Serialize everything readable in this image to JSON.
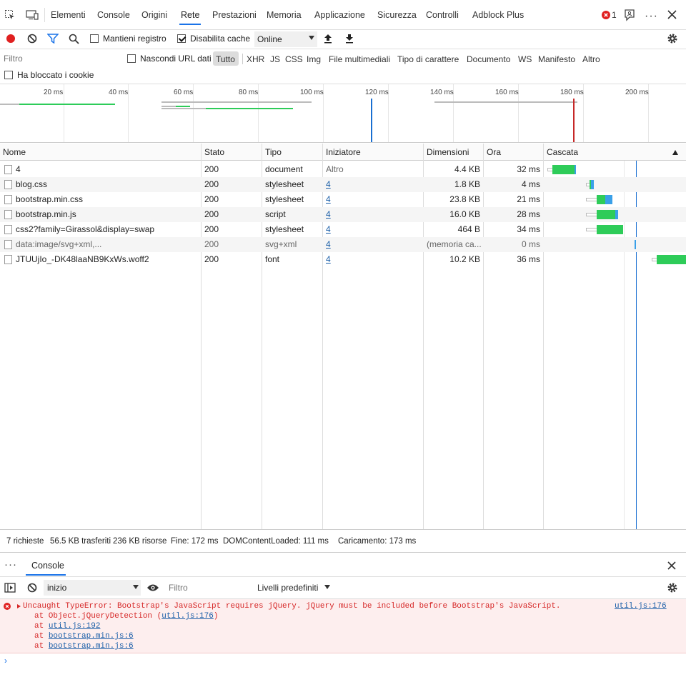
{
  "devtools_tabs": [
    {
      "label": "Elementi"
    },
    {
      "label": "Console"
    },
    {
      "label": "Origini"
    },
    {
      "label": "Rete",
      "active": true
    },
    {
      "label": "Prestazioni"
    },
    {
      "label": "Memoria"
    },
    {
      "label": "Applicazione"
    },
    {
      "label": "Sicurezza"
    },
    {
      "label": "Controlli"
    },
    {
      "label": "Adblock Plus"
    }
  ],
  "error_count": "1",
  "network_toolbar": {
    "preserve_log_label": "Mantieni registro",
    "preserve_log_checked": false,
    "disable_cache_label": "Disabilita cache",
    "disable_cache_checked": true,
    "throttling_value": "Online"
  },
  "filter_bar": {
    "filter_placeholder": "Filtro",
    "hide_data_urls_label": "Nascondi URL dati",
    "types": [
      "Tutto",
      "XHR",
      "JS",
      "CSS",
      "Img",
      "File multimediali",
      "Tipo di carattere",
      "Documento",
      "WS",
      "Manifesto",
      "Altro"
    ],
    "blocked_cookies_label": "Ha bloccato i cookie"
  },
  "overview": {
    "tick_labels": [
      "20 ms",
      "40 ms",
      "60 ms",
      "80 ms",
      "100 ms",
      "120 ms",
      "140 ms",
      "160 ms",
      "180 ms",
      "200 ms"
    ],
    "dom_content_loaded_ms": 111,
    "load_ms": 173
  },
  "table": {
    "columns": [
      "Nome",
      "Stato",
      "Tipo",
      "Iniziatore",
      "Dimensioni",
      "Ora",
      "Cascata"
    ],
    "rows": [
      {
        "name": "4",
        "status": "200",
        "type": "document",
        "initiator": "Altro",
        "size": "4.4 KB",
        "time": "32 ms"
      },
      {
        "name": "blog.css",
        "status": "200",
        "type": "stylesheet",
        "initiator": "4",
        "size": "1.8 KB",
        "time": "4 ms"
      },
      {
        "name": "bootstrap.min.css",
        "status": "200",
        "type": "stylesheet",
        "initiator": "4",
        "size": "23.8 KB",
        "time": "21 ms"
      },
      {
        "name": "bootstrap.min.js",
        "status": "200",
        "type": "script",
        "initiator": "4",
        "size": "16.0 KB",
        "time": "28 ms"
      },
      {
        "name": "css2?family=Girassol&display=swap",
        "status": "200",
        "type": "stylesheet",
        "initiator": "4",
        "size": "464 B",
        "time": "34 ms"
      },
      {
        "name": "data:image/svg+xml,...",
        "status": "200",
        "type": "svg+xml",
        "initiator": "4",
        "size": "(memoria ca...",
        "time": "0 ms"
      },
      {
        "name": "JTUUjIo_-DK48laaNB9KxWs.woff2",
        "status": "200",
        "type": "font",
        "initiator": "4",
        "size": "10.2 KB",
        "time": "36 ms"
      }
    ]
  },
  "status_bar": {
    "requests": "7 richieste",
    "transferred": "56.5 KB trasferiti",
    "resources": "236 KB risorse",
    "finish": "Fine: 172 ms",
    "dcl": "DOMContentLoaded: 111 ms",
    "load": "Caricamento: 173 ms"
  },
  "drawer": {
    "tab_label": "Console",
    "context_value": "inizio",
    "filter_placeholder": "Filtro",
    "levels_label": "Livelli predefiniti"
  },
  "console_error": {
    "message": "Uncaught TypeError: Bootstrap's JavaScript requires jQuery. jQuery must be included before Bootstrap's JavaScript.",
    "source": "util.js:176",
    "stack": [
      {
        "prefix": "at Object.jQueryDetection (",
        "link": "util.js:176",
        "suffix": ")"
      },
      {
        "prefix": "at ",
        "link": "util.js:192",
        "suffix": ""
      },
      {
        "prefix": "at ",
        "link": "bootstrap.min.js:6",
        "suffix": ""
      },
      {
        "prefix": "at ",
        "link": "bootstrap.min.js:6",
        "suffix": ""
      }
    ]
  },
  "colors": {
    "accent": "#1a73e8",
    "record": "#e02020",
    "error": "#d62828",
    "waterfall_green": "#2ecc59",
    "waterfall_blue": "#3aa0e8",
    "dcl_line": "#1a6fd1",
    "load_line": "#c62828"
  },
  "icons": [
    "inspect-icon",
    "device-icon",
    "error-icon",
    "feedback-icon",
    "more-icon",
    "close-icon",
    "record-icon",
    "clear-icon",
    "filter-icon",
    "search-icon",
    "upload-icon",
    "download-icon",
    "settings-icon",
    "file-icon",
    "sort-up-icon",
    "drawer-more-icon",
    "sidebar-toggle-icon",
    "eye-icon",
    "prompt-icon"
  ]
}
